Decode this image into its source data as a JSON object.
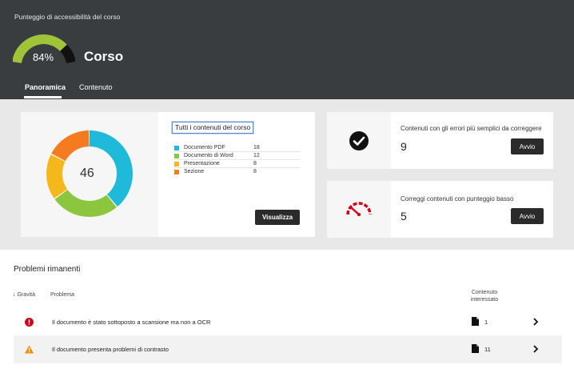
{
  "header": {
    "score_caption": "Punteggio di accessibilità del corso",
    "score_percent": "84%",
    "score_value": 0.84,
    "course_title": "Corso",
    "tabs": [
      {
        "label": "Panoramica",
        "active": true
      },
      {
        "label": "Contenuto",
        "active": false
      }
    ],
    "colors": {
      "background": "#3a3d40",
      "gauge_fill": "#9fc43a",
      "gauge_rest": "#111111"
    }
  },
  "overview": {
    "total": "46",
    "all_content_label": "Tutti i contenuti del corso",
    "legend": [
      {
        "label": "Documento PDF",
        "count": "18",
        "value": 18,
        "color": "#1fb9d9"
      },
      {
        "label": "Documento di Word",
        "count": "12",
        "value": 12,
        "color": "#8cc63f"
      },
      {
        "label": "Presentazione",
        "count": "8",
        "value": 8,
        "color": "#f5b81c"
      },
      {
        "label": "Sezione",
        "count": "8",
        "value": 8,
        "color": "#f47b20"
      }
    ],
    "view_button": "Visualizza"
  },
  "fix_cards": [
    {
      "description": "Contenuti con gli errori più semplici da correggere",
      "count": "9",
      "button": "Avvio",
      "icon": "checkmark-circle-icon"
    },
    {
      "description": "Correggi contenuti con punteggio basso",
      "count": "5",
      "button": "Avvio",
      "icon": "speedometer-low-icon"
    }
  ],
  "problems": {
    "title": "Problemi rimanenti",
    "columns": {
      "severity": "↓ Gravità",
      "problem": "Problema",
      "affected": "Contenuto interessato"
    },
    "rows": [
      {
        "severity": "severe",
        "icon": "error-circle-icon",
        "text": "Il documento è stato sottoposto a scansione ma non a OCR",
        "count": "1"
      },
      {
        "severity": "major",
        "icon": "warning-triangle-icon",
        "text": "Il documento presenta problemi di contrasto",
        "count": "11"
      }
    ]
  }
}
